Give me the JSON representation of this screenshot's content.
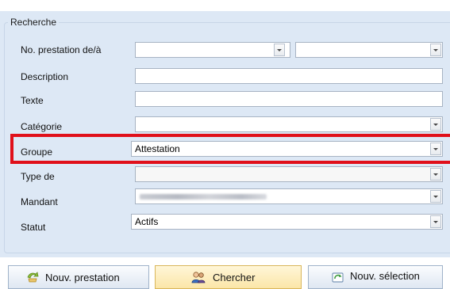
{
  "search": {
    "group_title": "Recherche",
    "rows": [
      {
        "label": "No. prestation de/à",
        "value_from": "",
        "value_to": ""
      },
      {
        "label": "Description",
        "value": ""
      },
      {
        "label": "Texte",
        "value": ""
      },
      {
        "label": "Catégorie",
        "value": ""
      },
      {
        "label": "Groupe",
        "value": "Attestation"
      },
      {
        "label": "Type de",
        "value": ""
      },
      {
        "label": "Mandant",
        "value": ""
      },
      {
        "label": "Statut",
        "value": "Actifs"
      }
    ]
  },
  "buttons": {
    "new_service": "Nouv. prestation",
    "search": "Chercher",
    "new_selection": "Nouv. sélection"
  },
  "colors": {
    "panel_bg": "#dde8f5",
    "highlight": "#e0101a",
    "active_button": "#fbe6a8"
  },
  "icons": {
    "new_service": "new-service-icon",
    "search": "search-people-icon",
    "new_selection": "refresh-selection-icon"
  }
}
